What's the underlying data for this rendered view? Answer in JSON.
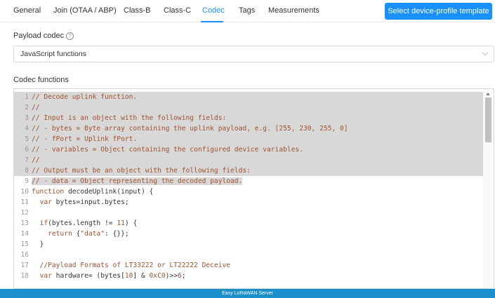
{
  "tabs": [
    {
      "label": "General"
    },
    {
      "label": "Join (OTAA / ABP)"
    },
    {
      "label": "Class-B"
    },
    {
      "label": "Class-C"
    },
    {
      "label": "Codec",
      "active": true
    },
    {
      "label": "Tags"
    },
    {
      "label": "Measurements"
    }
  ],
  "template_button": "Select device-profile template",
  "payload_codec": {
    "label": "Payload codec",
    "help_icon": "question-circle-icon",
    "selected": "JavaScript functions"
  },
  "codec_functions": {
    "label": "Codec functions",
    "lines": [
      {
        "n": "1",
        "text": "// Decode uplink function."
      },
      {
        "n": "2",
        "text": "//"
      },
      {
        "n": "3",
        "text": "// Input is an object with the following fields:"
      },
      {
        "n": "4",
        "text": "// - bytes = Byte array containing the uplink payload, e.g. [255, 230, 255, 0]"
      },
      {
        "n": "5",
        "text": "// - fPort = Uplink fPort."
      },
      {
        "n": "6",
        "text": "// - variables = Object containing the configured device variables."
      },
      {
        "n": "7",
        "text": "//"
      },
      {
        "n": "8",
        "text": "// Output must be an object with the following fields:"
      },
      {
        "n": "9",
        "text": "// - data = Object representing the decoded payload."
      },
      {
        "n": "10",
        "text": "function decodeUplink(input) {"
      },
      {
        "n": "11",
        "text": "  var bytes=input.bytes;"
      },
      {
        "n": "12",
        "text": ""
      },
      {
        "n": "13",
        "text": "  if(bytes.length != 11) {"
      },
      {
        "n": "14",
        "text": "    return {\"data\": {}};"
      },
      {
        "n": "15",
        "text": "  }"
      },
      {
        "n": "16",
        "text": ""
      },
      {
        "n": "17",
        "text": "  //Payload Formats of LT33222 or LT22222 Deceive"
      },
      {
        "n": "18",
        "text": "  var hardware= (bytes[10] & 0xC0)>>6;"
      }
    ]
  },
  "footer": "Easy LoRaWAN Server",
  "colors": {
    "accent": "#1890ff",
    "footer": "#1b8fc9",
    "selection": "#d8d8d8"
  }
}
